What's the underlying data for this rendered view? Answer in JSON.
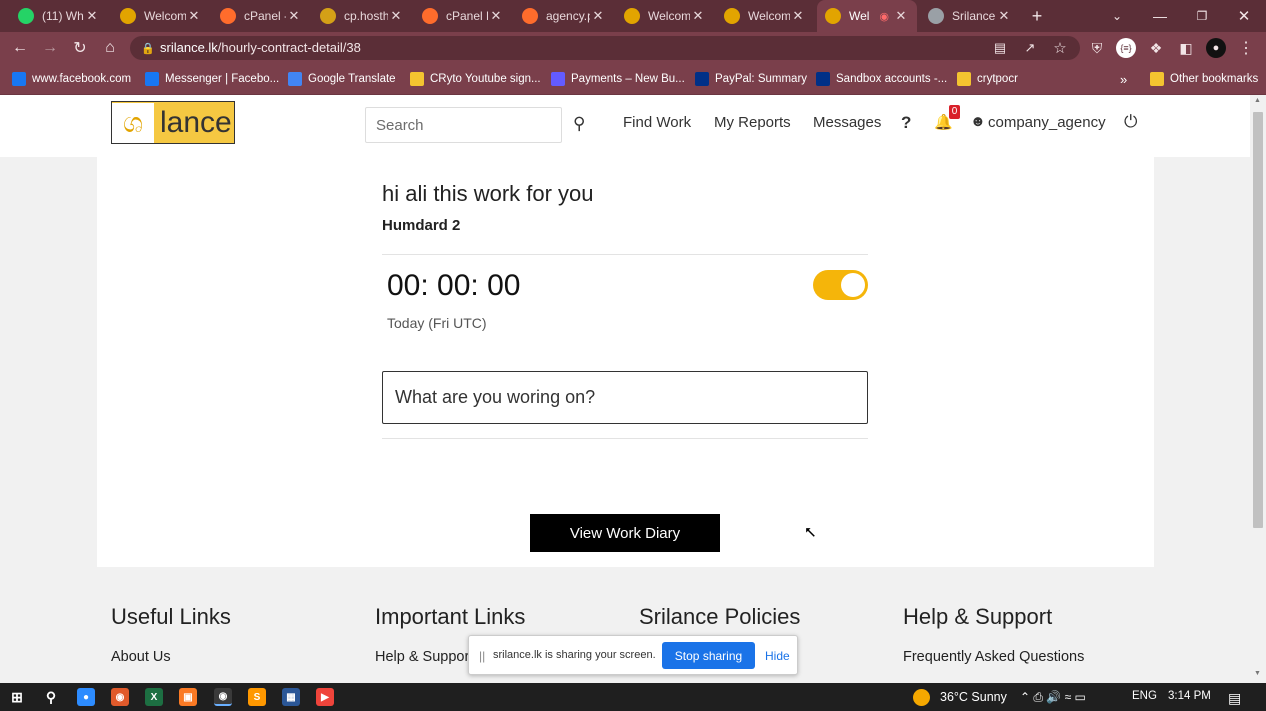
{
  "tabs": [
    {
      "title": "(11) Wh",
      "icon": "whatsapp-icon",
      "color": "#25d366"
    },
    {
      "title": "Welcom",
      "icon": "srilance-icon",
      "color": "#e2a400"
    },
    {
      "title": "cPanel -",
      "icon": "cpanel-icon",
      "color": "#ff6c2c"
    },
    {
      "title": "cp.hosth",
      "icon": "hosting-icon",
      "color": "#d4a017"
    },
    {
      "title": "cPanel F",
      "icon": "cpanel-icon",
      "color": "#ff6c2c"
    },
    {
      "title": "agency.p",
      "icon": "cpanel-icon",
      "color": "#ff6c2c"
    },
    {
      "title": "Welcom",
      "icon": "srilance-icon",
      "color": "#e2a400"
    },
    {
      "title": "Welcom",
      "icon": "srilance-icon",
      "color": "#e2a400"
    },
    {
      "title": "Wel",
      "icon": "srilance-icon",
      "color": "#e2a400"
    },
    {
      "title": "Srilance",
      "icon": "globe-icon",
      "color": "#9aa0a6"
    }
  ],
  "browser": {
    "url_host": "srilance.lk",
    "url_path": "/hourly-contract-detail/38"
  },
  "bookmarks": [
    {
      "label": "www.facebook.com",
      "icon": "facebook-icon",
      "color": "#1877f2"
    },
    {
      "label": "Messenger | Facebo...",
      "icon": "facebook-icon",
      "color": "#1877f2"
    },
    {
      "label": "Google Translate",
      "icon": "translate-icon",
      "color": "#4285f4"
    },
    {
      "label": "CRyto Youtube sign...",
      "icon": "folder-icon",
      "color": "#f4c430"
    },
    {
      "label": "Payments – New Bu...",
      "icon": "stripe-icon",
      "color": "#635bff"
    },
    {
      "label": "PayPal: Summary",
      "icon": "paypal-icon",
      "color": "#003087"
    },
    {
      "label": "Sandbox accounts -...",
      "icon": "paypal-icon",
      "color": "#003087"
    },
    {
      "label": "crytpocr",
      "icon": "folder-icon",
      "color": "#f4c430"
    }
  ],
  "other_bookmarks": "Other bookmarks",
  "more_bookmarks": "»",
  "logo": {
    "mark": "ශ",
    "word": "lance"
  },
  "header": {
    "search_placeholder": "Search",
    "nav": [
      "Find Work",
      "My Reports",
      "Messages"
    ],
    "help": "?",
    "notif_count": "0",
    "username": "company_agency"
  },
  "contract": {
    "title": "hi ali this work for you",
    "client": "Humdard 2",
    "timer": "00: 00: 00",
    "date_label": "Today (Fri UTC)",
    "tracking_on": true,
    "work_placeholder": "What are you woring on?",
    "diary_button": "View Work Diary"
  },
  "footer": {
    "columns": [
      {
        "heading": "Useful Links",
        "link": "About Us"
      },
      {
        "heading": "Important Links",
        "link": "Help & Support"
      },
      {
        "heading": "Srilance Policies",
        "link": ""
      },
      {
        "heading": "Help & Support",
        "link": "Frequently Asked Questions"
      }
    ]
  },
  "sharebar": {
    "grip": "||",
    "message": "srilance.lk is sharing your screen.",
    "stop": "Stop sharing",
    "hide": "Hide"
  },
  "tray": {
    "weather": "36°C  Sunny",
    "lang": "ENG",
    "time": "3:14 PM"
  },
  "colors": {
    "accent": "#f5b50a",
    "browser_frame": "#7a3f4b",
    "share_button": "#1a73e8"
  }
}
